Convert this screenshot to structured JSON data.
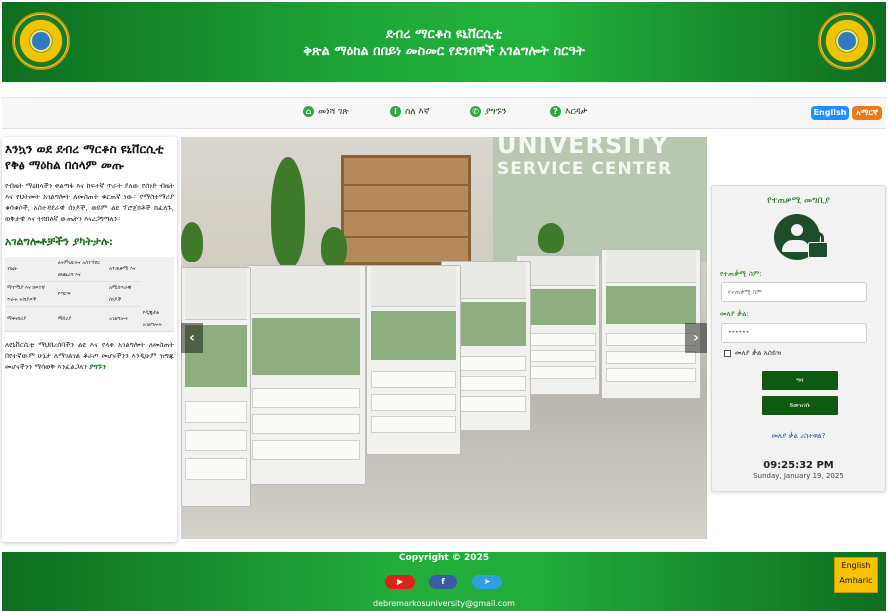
{
  "header": {
    "title_line1": "ደብረ ማርቆስ ዩኒቨርሲቲ",
    "title_line2": "ቅጽል ማዕከል በበይነ መስመር የደንበኞች አገልግሎት ስርዓት"
  },
  "nav": {
    "items": [
      {
        "label": "መነሻ ገጽ",
        "icon": "home-icon"
      },
      {
        "label": "ስለ እኛ",
        "icon": "info-icon"
      },
      {
        "label": "ያግኙን",
        "icon": "phone-icon"
      },
      {
        "label": "እርዳታ",
        "icon": "help-icon"
      }
    ],
    "lang_en": "English",
    "lang_am": "አማርኛ"
  },
  "info": {
    "heading": "እንኳን ወደ ደብረ ማርቆስ ዩኒቨርሲቲ የቅፅ ማዕከል በሰላም መጡ",
    "intro": "የብዜት ማዕከላችን ቀልጣፋ እና ከፍተኛ ጥራት ያለው የሰነድ ብዜት እና የህትመት አገልግሎት ለመስጠት ቁርጠኛ ነው። የማስተማሪያ ቁሳቁሶች, አስተዳደራዊ ሰነዶች, ወይም ልዩ ፕሮጀክቶች ከፈለጉ, ወቅታዊ እና ትክክለኛ ውጤትን እናረጋግጣለን።",
    "services_heading": "አገልግሎቶቻችን ያካትታሉ:",
    "services": [
      [
        "ብዜት",
        "ለትምህርትና አስተዳደር መጨረሻ እና",
        "ለተጠቃሚ እና"
      ],
      [
        "ማተሚያ እና ከፍተኛ ጥራት ትሽያዎች",
        "ዮግሮፍ",
        "ለሚስጥራዊ ሰነዶች"
      ],
      [
        "ማቀናበሪያ",
        "ማሰሪያ",
        "አገልግሎት",
        "የዲጂታል አገልግሎት"
      ]
    ],
    "outro": "ለዩኒቨርሲቲ ማህበረሰባችን ልዩ እና የላቀ አገልግሎት ለመስጠት በየትኛውም ሁኔታ ለማገልገል ቆራጦ መሆናችንን እንዲሁም ዝግጁ መሆናችንን ማሳወቅ እንፈልጋለን",
    "outro_link": "ያግኙን"
  },
  "hero": {
    "sign_line1": "UNIVERSITY",
    "sign_line2": "SERVICE CENTER",
    "prev": "‹",
    "next": "›"
  },
  "login": {
    "title": "የተጠቃሚ መግቢያ",
    "username_label": "የተጠቃሚ ስም:",
    "username_placeholder": "የተጠቃሚ ስም",
    "password_label": "መለያ ቃል:",
    "password_value": "••••••",
    "remember_label": "መለያ ቃል አስይዝ",
    "login_btn": "ግባ",
    "register_btn": "ይመዝገቡ",
    "forgot": "መለያ ቃል ረስተዋል?",
    "time": "09:25:32 PM",
    "date": "Sunday, January 19, 2025"
  },
  "footer": {
    "copyright": "Copyright © 2025",
    "youtube": "▶",
    "facebook": "f",
    "telegram": "➤",
    "email": "debremarkosuniversity@gmail.com",
    "lang_en": "English",
    "lang_am": "Amharic"
  },
  "colors": {
    "brand_green": "#22ad3b",
    "dark_green": "#0f5a12",
    "english_blue": "#1e90ff",
    "amharic_orange": "#f07a1a",
    "footer_lang_yellow": "#f7c300"
  }
}
